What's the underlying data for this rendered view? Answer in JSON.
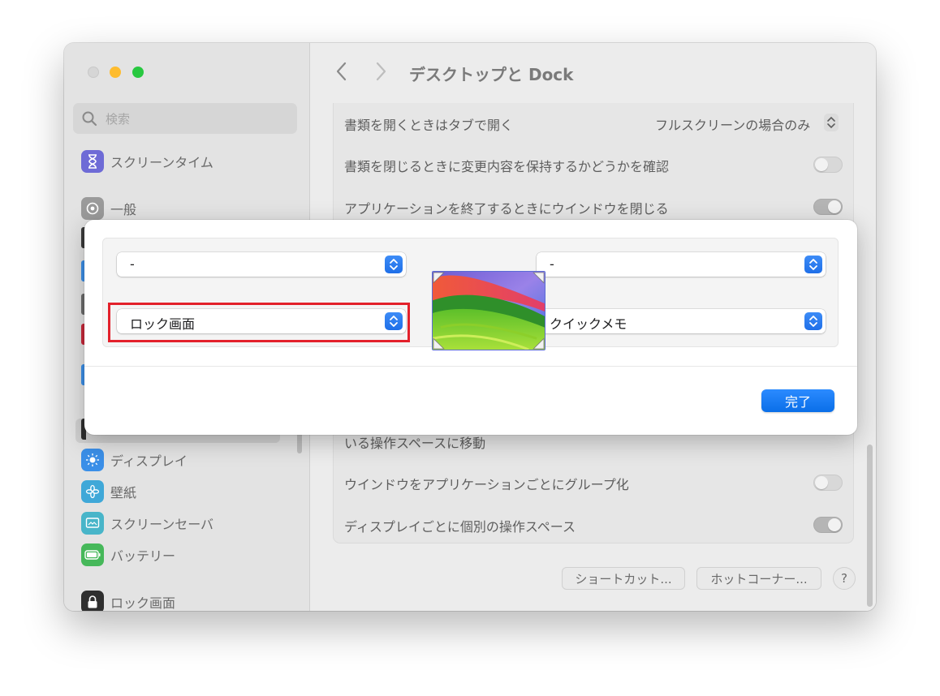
{
  "window": {
    "title": "デスクトップと Dock"
  },
  "search": {
    "placeholder": "検索"
  },
  "sidebar": {
    "items": [
      {
        "label": "スクリーンタイム",
        "icon": "hourglass-icon",
        "color": "#6e6bd6"
      },
      {
        "label": "一般",
        "icon": "gear-icon",
        "color": "#9a9a9a"
      },
      {
        "label": "ディスプレイ",
        "icon": "sun-icon",
        "color": "#3b8fe8"
      },
      {
        "label": "壁紙",
        "icon": "flower-icon",
        "color": "#3fa8d8"
      },
      {
        "label": "スクリーンセーバ",
        "icon": "screensaver-icon",
        "color": "#48b5c9"
      },
      {
        "label": "バッテリー",
        "icon": "battery-icon",
        "color": "#46b85a"
      },
      {
        "label": "ロック画面",
        "icon": "lock-icon",
        "color": "#2f2f2f"
      }
    ]
  },
  "settings": {
    "rows_top": [
      {
        "label": "書類を開くときはタブで開く",
        "value": "フルスクリーンの場合のみ"
      },
      {
        "label": "書類を閉じるときに変更内容を保持するかどうかを確認",
        "toggle": false
      },
      {
        "label": "アプリケーションを終了するときにウインドウを閉じる",
        "toggle": true
      }
    ],
    "partial_row": "いる操作スペースに移動",
    "rows_bottom": [
      {
        "label": "ウインドウをアプリケーションごとにグループ化",
        "toggle": false
      },
      {
        "label": "ディスプレイごとに個別の操作スペース",
        "toggle": true
      }
    ],
    "buttons": {
      "shortcuts": "ショートカット...",
      "hot_corners": "ホットコーナー...",
      "help": "?"
    }
  },
  "sheet": {
    "top_left": "-",
    "top_right": "-",
    "bottom_left": "ロック画面",
    "bottom_right": "クイックメモ",
    "done": "完了"
  },
  "colors": {
    "accent": "#0a6fe8",
    "highlight": "#e3212b"
  }
}
